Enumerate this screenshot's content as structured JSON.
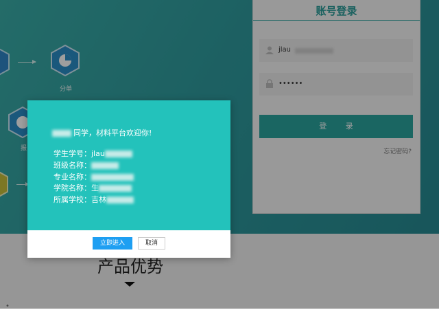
{
  "hero": {
    "step_label_left_partial": "报",
    "step_label_analysis": "分单",
    "icons": [
      "hexagon-step-icon",
      "pie-chart-icon",
      "clock-icon"
    ]
  },
  "login": {
    "title": "账号登录",
    "username_value": "jlau",
    "password_value": "••••••",
    "submit_label": "登 录",
    "forgot_label": "忘记密码?"
  },
  "lower": {
    "section_title": "产品优势"
  },
  "modal": {
    "welcome_suffix": "同学，材料平台欢迎你!",
    "fields": [
      {
        "label": "学生学号：",
        "value": "jlau"
      },
      {
        "label": "班级名称：",
        "value": ""
      },
      {
        "label": "专业名称：",
        "value": ""
      },
      {
        "label": "学院名称：",
        "value": "生"
      },
      {
        "label": "所属学校：",
        "value": "吉林"
      }
    ],
    "enter_label": "立即进入",
    "cancel_label": "取消"
  },
  "colors": {
    "hero_teal": "#2f9c9f",
    "modal_teal": "#23c2bb",
    "primary_blue": "#1e9ff2",
    "login_button": "#2aa59f"
  }
}
